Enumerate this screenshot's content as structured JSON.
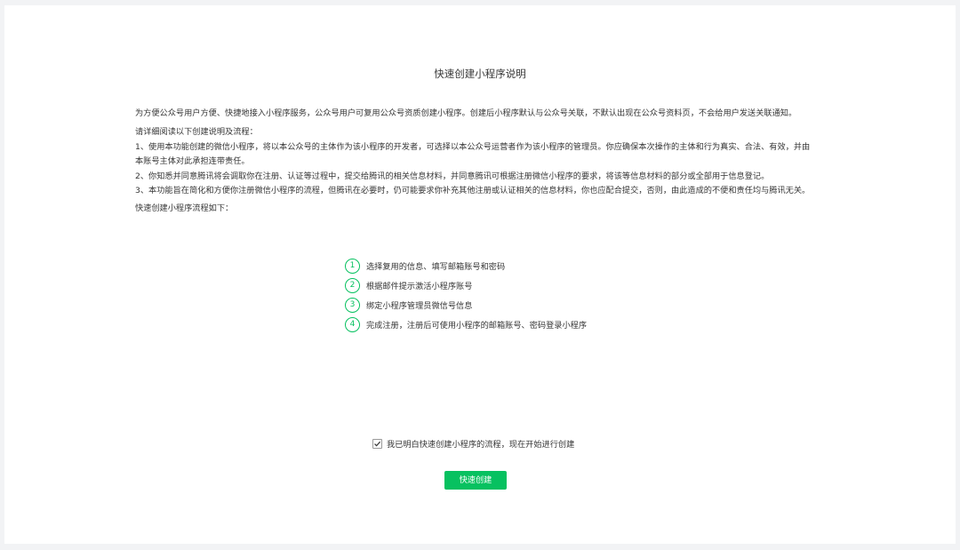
{
  "page": {
    "title": "快速创建小程序说明"
  },
  "intro": "为方便公众号用户方便、快捷地接入小程序服务，公众号用户可复用公众号资质创建小程序。创建后小程序默认与公众号关联，不默认出现在公众号资料页，不会给用户发送关联通知。",
  "rules": {
    "heading": "请详细阅读以下创建说明及流程：",
    "lines": [
      "1、使用本功能创建的微信小程序，将以本公众号的主体作为该小程序的开发者，可选择以本公众号运营者作为该小程序的管理员。你应确保本次操作的主体和行为真实、合法、有效，并由",
      "本账号主体对此承担连带责任。",
      "2、你知悉并同意腾讯将会调取你在注册、认证等过程中，提交给腾讯的相关信息材料，并同意腾讯可根据注册微信小程序的要求，将该等信息材料的部分或全部用于信息登记。",
      "3、本功能旨在简化和方便你注册微信小程序的流程，但腾讯在必要时，仍可能要求你补充其他注册或认证相关的信息材料，你也应配合提交，否则，由此造成的不便和责任均与腾讯无关。"
    ]
  },
  "flow_label": "快速创建小程序流程如下：",
  "steps": [
    {
      "num": "1",
      "text": "选择复用的信息、填写邮箱账号和密码"
    },
    {
      "num": "2",
      "text": "根据邮件提示激活小程序账号"
    },
    {
      "num": "3",
      "text": "绑定小程序管理员微信号信息"
    },
    {
      "num": "4",
      "text": "完成注册，注册后可使用小程序的邮箱账号、密码登录小程序"
    }
  ],
  "agreement": {
    "checked": true,
    "label": "我已明白快速创建小程序的流程，现在开始进行创建"
  },
  "actions": {
    "create_label": "快速创建"
  },
  "colors": {
    "accent": "#07c160",
    "background": "#f2f3f5",
    "text": "#353535"
  },
  "icons": {
    "checkbox": "check-icon"
  }
}
